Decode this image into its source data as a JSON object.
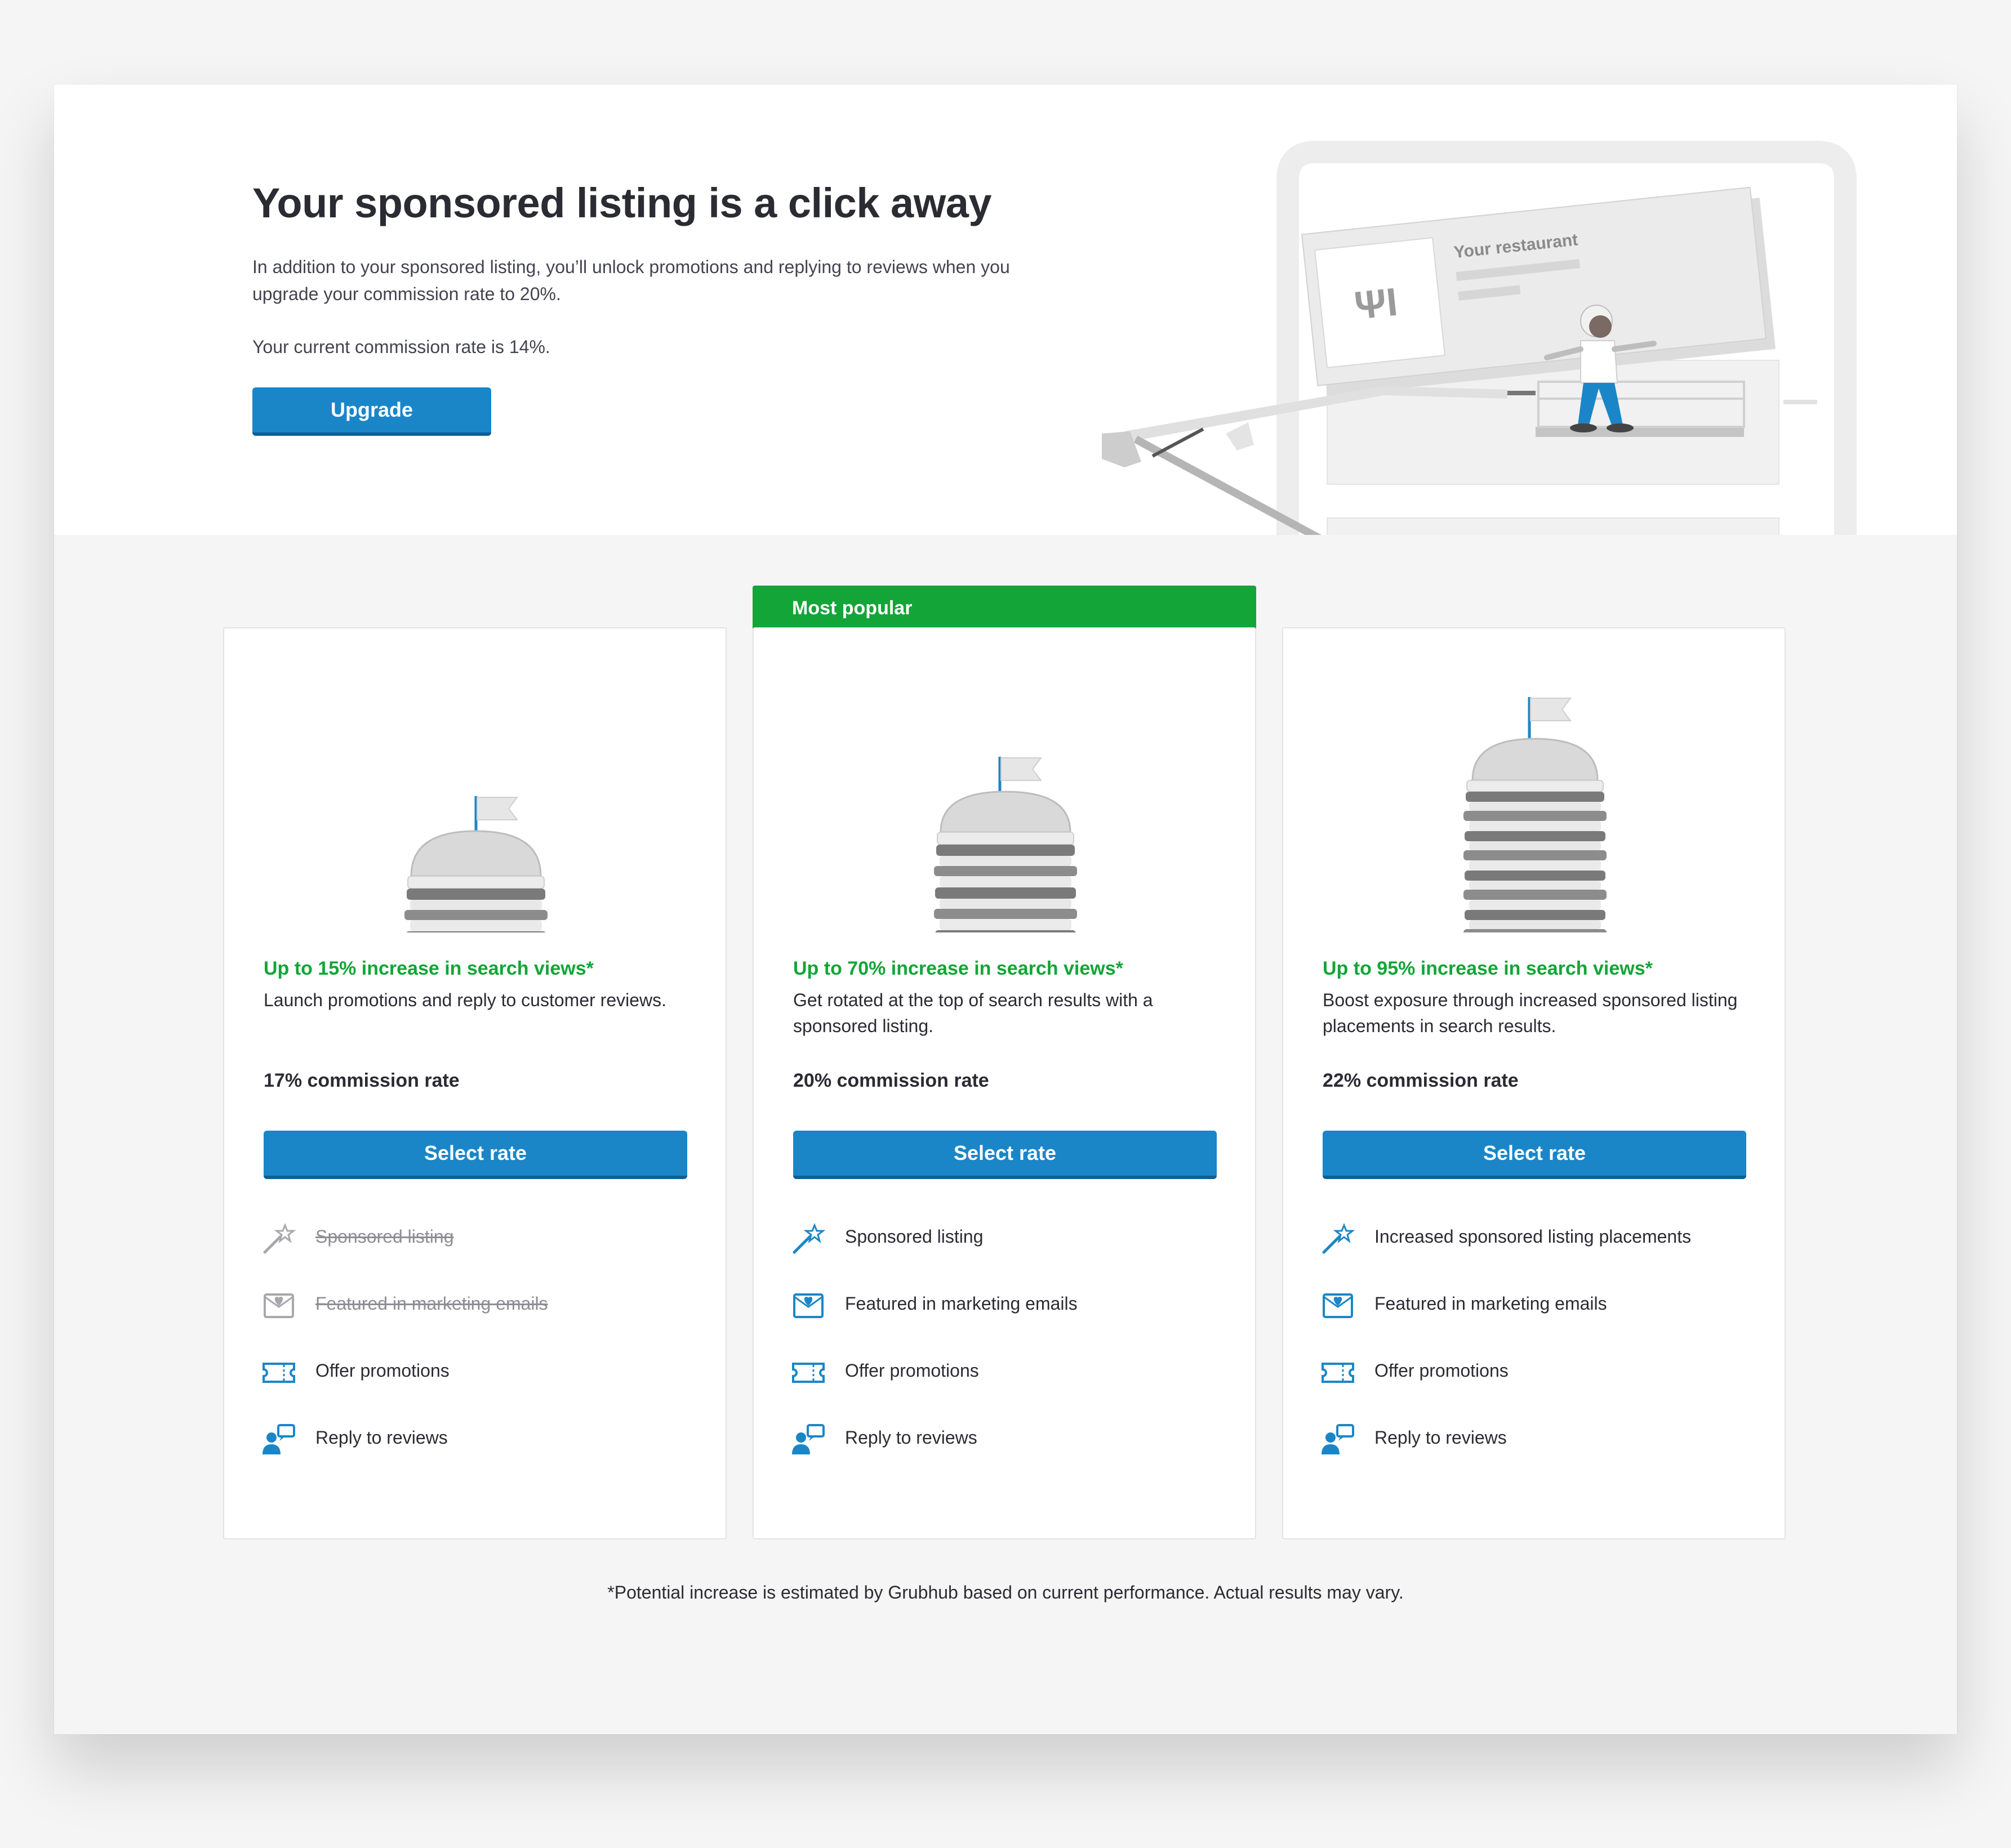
{
  "hero": {
    "title": "Your sponsored listing is a click away",
    "description": "In addition to your sponsored listing, you’ll unlock promotions and replying to reviews when you upgrade your commission rate to 20%.",
    "current_rate": "Your current commission rate is 14%.",
    "upgrade_label": "Upgrade",
    "illustration_label": "Your restaurant"
  },
  "popular_banner": "Most popular",
  "plans": [
    {
      "headline": "Up to 15% increase in search views*",
      "description": "Launch promotions and reply to customer reviews.",
      "rate": "17% commission rate",
      "button": "Select rate",
      "features": [
        {
          "label": "Sponsored listing",
          "icon": "magic-wand-icon",
          "included": false
        },
        {
          "label": "Featured in marketing emails",
          "icon": "email-heart-icon",
          "included": false
        },
        {
          "label": "Offer promotions",
          "icon": "ticket-icon",
          "included": true
        },
        {
          "label": "Reply to reviews",
          "icon": "reply-chat-icon",
          "included": true
        }
      ]
    },
    {
      "headline": "Up to 70% increase in search views*",
      "description": "Get rotated at the top of search results with a sponsored listing.",
      "rate": "20% commission rate",
      "button": "Select rate",
      "features": [
        {
          "label": "Sponsored listing",
          "icon": "magic-wand-icon",
          "included": true
        },
        {
          "label": "Featured in marketing emails",
          "icon": "email-heart-icon",
          "included": true
        },
        {
          "label": "Offer promotions",
          "icon": "ticket-icon",
          "included": true
        },
        {
          "label": "Reply to reviews",
          "icon": "reply-chat-icon",
          "included": true
        }
      ]
    },
    {
      "headline": "Up to 95% increase in search views*",
      "description": "Boost exposure through increased sponsored listing placements in search results.",
      "rate": "22% commission rate",
      "button": "Select rate",
      "features": [
        {
          "label": "Increased sponsored listing placements",
          "icon": "magic-wand-icon",
          "included": true
        },
        {
          "label": "Featured in marketing emails",
          "icon": "email-heart-icon",
          "included": true
        },
        {
          "label": "Offer promotions",
          "icon": "ticket-icon",
          "included": true
        },
        {
          "label": "Reply to reviews",
          "icon": "reply-chat-icon",
          "included": true
        }
      ]
    }
  ],
  "footnote": "*Potential increase is estimated by Grubhub based on current performance. Actual results may vary.",
  "colors": {
    "accent_blue": "#1a86c8",
    "success_green": "#13a538",
    "text_dark": "#2b2b33",
    "disabled_gray": "#8d8d94"
  }
}
